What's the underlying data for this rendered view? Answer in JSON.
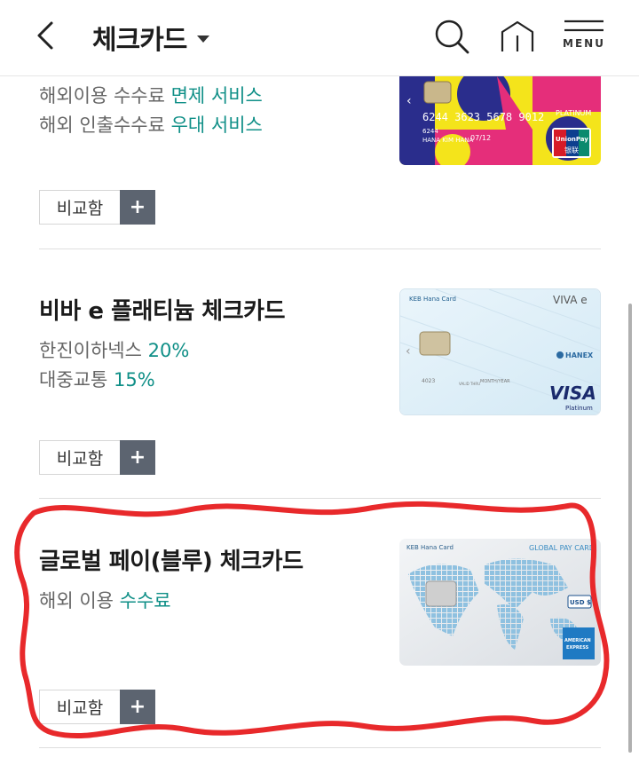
{
  "header": {
    "title": "체크카드",
    "menu_label": "MENU"
  },
  "items": [
    {
      "benefits": [
        {
          "text": "해외이용 수수료 ",
          "highlight": "면제 서비스"
        },
        {
          "text": "해외 인출수수료 ",
          "highlight": "우대 서비스"
        }
      ],
      "compare_label": "비교함",
      "compare_plus": "+",
      "card_face": {
        "number": "6244 3623 5678 9012",
        "tier": "PLATINUM",
        "short": "6244",
        "holder": "HANA KIM HANA",
        "valid": "07/12",
        "brand": "UnionPay",
        "brand_sub": "银联"
      }
    },
    {
      "name": "비바 e 플래티늄 체크카드",
      "benefits": [
        {
          "text": "한진이하넥스 ",
          "highlight": "20%"
        },
        {
          "text": "대중교통 ",
          "highlight": "15%"
        }
      ],
      "compare_label": "비교함",
      "compare_plus": "+",
      "card_face": {
        "issuer": "KEB Hana Card",
        "product": "VIVA e",
        "partner": "HANEX",
        "short": "4023",
        "brand": "VISA",
        "tier": "Platinum",
        "valid_label": "MONTH/YEAR",
        "thru_label": "VALID THRU"
      }
    },
    {
      "name": "글로벌 페이(블루) 체크카드",
      "benefits": [
        {
          "text": "해외 이용 ",
          "highlight": "수수료"
        }
      ],
      "compare_label": "비교함",
      "compare_plus": "+",
      "card_face": {
        "issuer": "KEB Hana Card",
        "product": "GLOBAL PAY CARD",
        "currency": "USD $",
        "brand_top": "AMERICAN",
        "brand_bottom": "EXPRESS"
      }
    }
  ],
  "colors": {
    "accent": "#0f8f87",
    "plus_bg": "#5c6470",
    "annotation": "#e8292b"
  }
}
